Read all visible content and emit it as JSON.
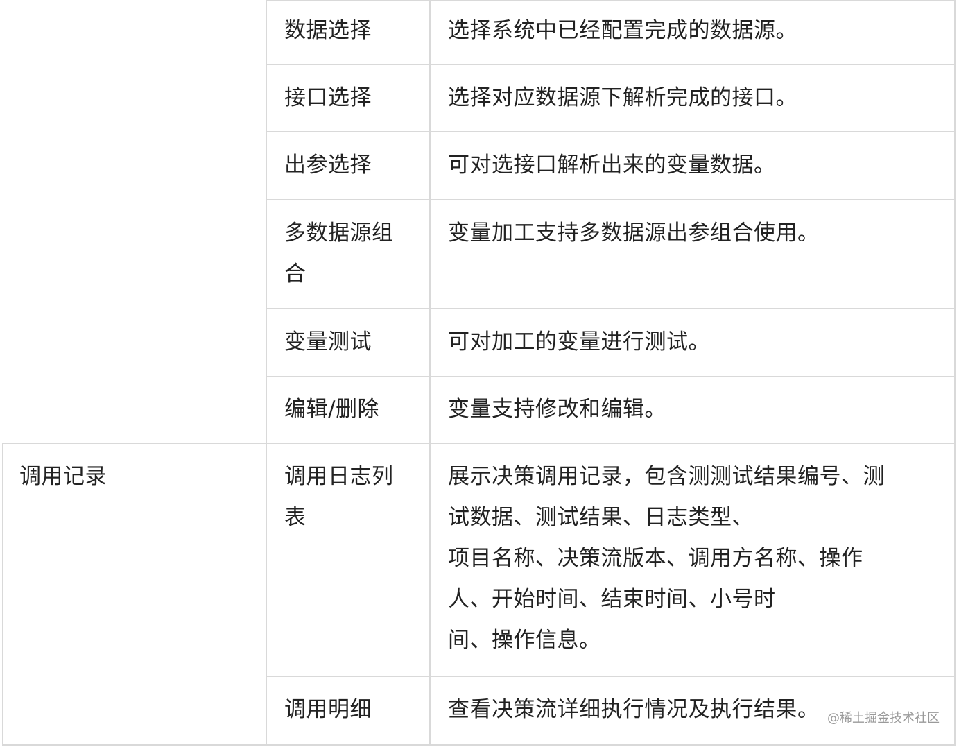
{
  "rows": [
    {
      "feature": "数据选择",
      "desc": "选择系统中已经配置完成的数据源。"
    },
    {
      "feature": "接口选择",
      "desc": "选择对应数据源下解析完成的接口。"
    },
    {
      "feature": "出参选择",
      "desc": "可对选接口解析出来的变量数据。"
    },
    {
      "feature_lines": [
        "多数据源组",
        "合"
      ],
      "desc": "变量加工支持多数据源出参组合使用。"
    },
    {
      "feature": "变量测试",
      "desc": "可对加工的变量进行测试。"
    },
    {
      "feature": "编辑/删除",
      "desc": "变量支持修改和编辑。"
    },
    {
      "module": "调用记录",
      "feature_lines": [
        "调用日志列",
        "表"
      ],
      "desc_lines": [
        "展示决策调用记录，包含测测试结果编号、测",
        "试数据、测试结果、日志类型、",
        "项目名称、决策流版本、调用方名称、操作",
        "人、开始时间、结束时间、小号时",
        "间、操作信息。"
      ]
    },
    {
      "feature": "调用明细",
      "desc": "查看决策流详细执行情况及执行结果。"
    }
  ],
  "watermark": "@稀土掘金技术社区"
}
